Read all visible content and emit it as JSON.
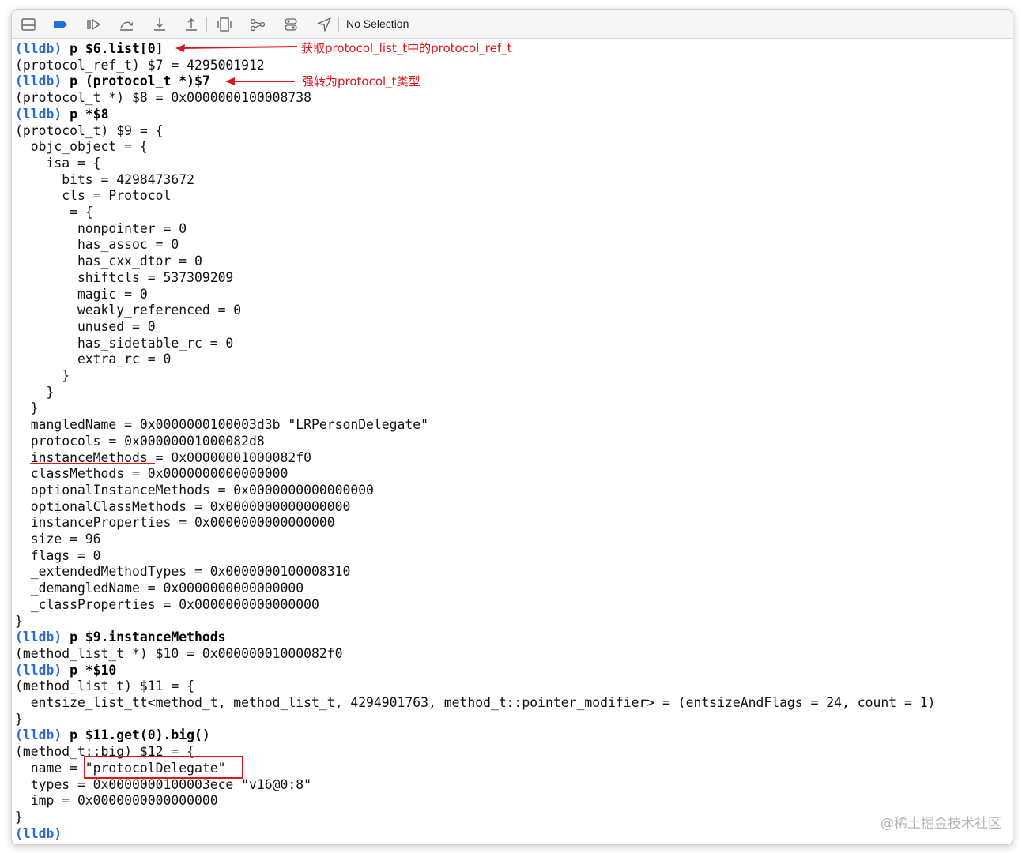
{
  "toolbar": {
    "icons": [
      "hide-console-icon",
      "breakpoints-icon",
      "continue-icon",
      "step-over-icon",
      "step-into-icon",
      "step-out-icon",
      "debug-view-hierarchy-icon",
      "memory-graph-icon",
      "environment-overrides-icon",
      "simulate-location-icon"
    ],
    "status": "No Selection"
  },
  "colors": {
    "prompt": "#2b6cd0",
    "annotation": "#e0161c",
    "text": "#111111"
  },
  "console": {
    "prompt": "(lldb)",
    "lines": [
      {
        "type": "cmd",
        "text": "p $6.list[0]"
      },
      {
        "type": "out",
        "text": "(protocol_ref_t) $7 = 4295001912"
      },
      {
        "type": "cmd",
        "text": "p (protocol_t *)$7"
      },
      {
        "type": "out",
        "text": "(protocol_t *) $8 = 0x0000000100008738"
      },
      {
        "type": "cmd",
        "text": "p *$8"
      },
      {
        "type": "out",
        "text": "(protocol_t) $9 = {"
      },
      {
        "type": "out",
        "text": "  objc_object = {"
      },
      {
        "type": "out",
        "text": "    isa = {"
      },
      {
        "type": "out",
        "text": "      bits = 4298473672"
      },
      {
        "type": "out",
        "text": "      cls = Protocol"
      },
      {
        "type": "out",
        "text": "       = {"
      },
      {
        "type": "out",
        "text": "        nonpointer = 0"
      },
      {
        "type": "out",
        "text": "        has_assoc = 0"
      },
      {
        "type": "out",
        "text": "        has_cxx_dtor = 0"
      },
      {
        "type": "out",
        "text": "        shiftcls = 537309209"
      },
      {
        "type": "out",
        "text": "        magic = 0"
      },
      {
        "type": "out",
        "text": "        weakly_referenced = 0"
      },
      {
        "type": "out",
        "text": "        unused = 0"
      },
      {
        "type": "out",
        "text": "        has_sidetable_rc = 0"
      },
      {
        "type": "out",
        "text": "        extra_rc = 0"
      },
      {
        "type": "out",
        "text": "      }"
      },
      {
        "type": "out",
        "text": "    }"
      },
      {
        "type": "out",
        "text": "  }"
      },
      {
        "type": "out",
        "text": "  mangledName = 0x0000000100003d3b \"LRPersonDelegate\""
      },
      {
        "type": "out",
        "text": "  protocols = 0x00000001000082d8"
      },
      {
        "type": "out",
        "text": "  instanceMethods = 0x00000001000082f0"
      },
      {
        "type": "out",
        "text": "  classMethods = 0x0000000000000000"
      },
      {
        "type": "out",
        "text": "  optionalInstanceMethods = 0x0000000000000000"
      },
      {
        "type": "out",
        "text": "  optionalClassMethods = 0x0000000000000000"
      },
      {
        "type": "out",
        "text": "  instanceProperties = 0x0000000000000000"
      },
      {
        "type": "out",
        "text": "  size = 96"
      },
      {
        "type": "out",
        "text": "  flags = 0"
      },
      {
        "type": "out",
        "text": "  _extendedMethodTypes = 0x0000000100008310"
      },
      {
        "type": "out",
        "text": "  _demangledName = 0x0000000000000000"
      },
      {
        "type": "out",
        "text": "  _classProperties = 0x0000000000000000"
      },
      {
        "type": "out",
        "text": "}"
      },
      {
        "type": "cmd",
        "text": "p $9.instanceMethods"
      },
      {
        "type": "out",
        "text": "(method_list_t *) $10 = 0x00000001000082f0"
      },
      {
        "type": "cmd",
        "text": "p *$10"
      },
      {
        "type": "out",
        "text": "(method_list_t) $11 = {"
      },
      {
        "type": "out",
        "text": "  entsize_list_tt<method_t, method_list_t, 4294901763, method_t::pointer_modifier> = (entsizeAndFlags = 24, count = 1)"
      },
      {
        "type": "out",
        "text": "}"
      },
      {
        "type": "cmd",
        "text": "p $11.get(0).big()"
      },
      {
        "type": "out",
        "text": "(method_t::big) $12 = {"
      },
      {
        "type": "out",
        "text": "  name = \"protocolDelegate\""
      },
      {
        "type": "out",
        "text": "  types = 0x0000000100003ece \"v16@0:8\""
      },
      {
        "type": "out",
        "text": "  imp = 0x0000000000000000"
      },
      {
        "type": "out",
        "text": "}"
      },
      {
        "type": "cmd",
        "text": ""
      }
    ]
  },
  "annotations": {
    "first": "获取protocol_list_t中的protocol_ref_t",
    "second": "强转为protocol_t类型"
  },
  "watermark": "@稀土掘金技术社区"
}
